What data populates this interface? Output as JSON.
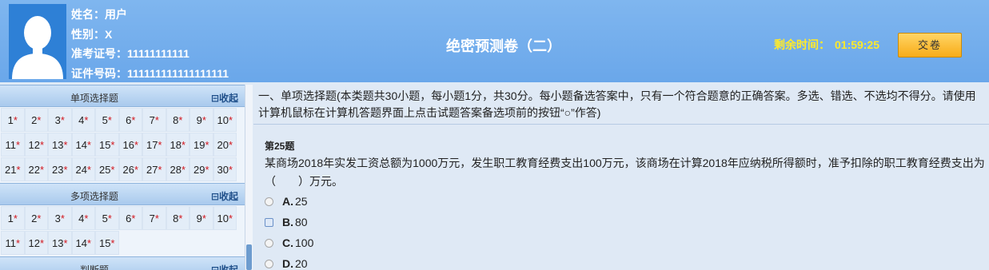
{
  "candidate": {
    "name": "姓名：用户",
    "gender": "性别：X",
    "exam_id": "准考证号：11111111111",
    "id_number": "证件号码：111111111111111111"
  },
  "exam": {
    "title": "绝密预测卷（二）",
    "timer_label": "剩余时间：",
    "timer_value": "01:59:25",
    "submit_label": "交卷"
  },
  "sections": [
    {
      "title": "单项选择题",
      "collapse_label": "⊟收起",
      "items": [
        "1",
        "2",
        "3",
        "4",
        "5",
        "6",
        "7",
        "8",
        "9",
        "10",
        "11",
        "12",
        "13",
        "14",
        "15",
        "16",
        "17",
        "18",
        "19",
        "20",
        "21",
        "22",
        "23",
        "24",
        "25",
        "26",
        "27",
        "28",
        "29",
        "30"
      ]
    },
    {
      "title": "多项选择题",
      "collapse_label": "⊟收起",
      "items": [
        "1",
        "2",
        "3",
        "4",
        "5",
        "6",
        "7",
        "8",
        "9",
        "10",
        "11",
        "12",
        "13",
        "14",
        "15"
      ]
    },
    {
      "title": "判断题",
      "collapse_label": "⊟收起",
      "items": []
    }
  ],
  "instructions": "一、单项选择题(本类题共30小题，每小题1分，共30分。每小题备选答案中，只有一个符合题意的正确答案。多选、错选、不选均不得分。请使用计算机鼠标在计算机答题界面上点击试题答案备选项前的按钮“○”作答)",
  "question": {
    "number": "第25题",
    "text": "某商场2018年实发工资总额为1000万元，发生职工教育经费支出100万元，该商场在计算2018年应纳税所得额时，准予扣除的职工教育经费支出为（　　）万元。",
    "options": [
      {
        "key": "A.",
        "value": "25"
      },
      {
        "key": "B.",
        "value": "80"
      },
      {
        "key": "C.",
        "value": "100"
      },
      {
        "key": "D.",
        "value": "20"
      }
    ]
  },
  "colors": {
    "header_bg": "#6aa7ea",
    "timer": "#ffea2a",
    "star": "#d3161c",
    "submit_button": "#f8ac18"
  }
}
